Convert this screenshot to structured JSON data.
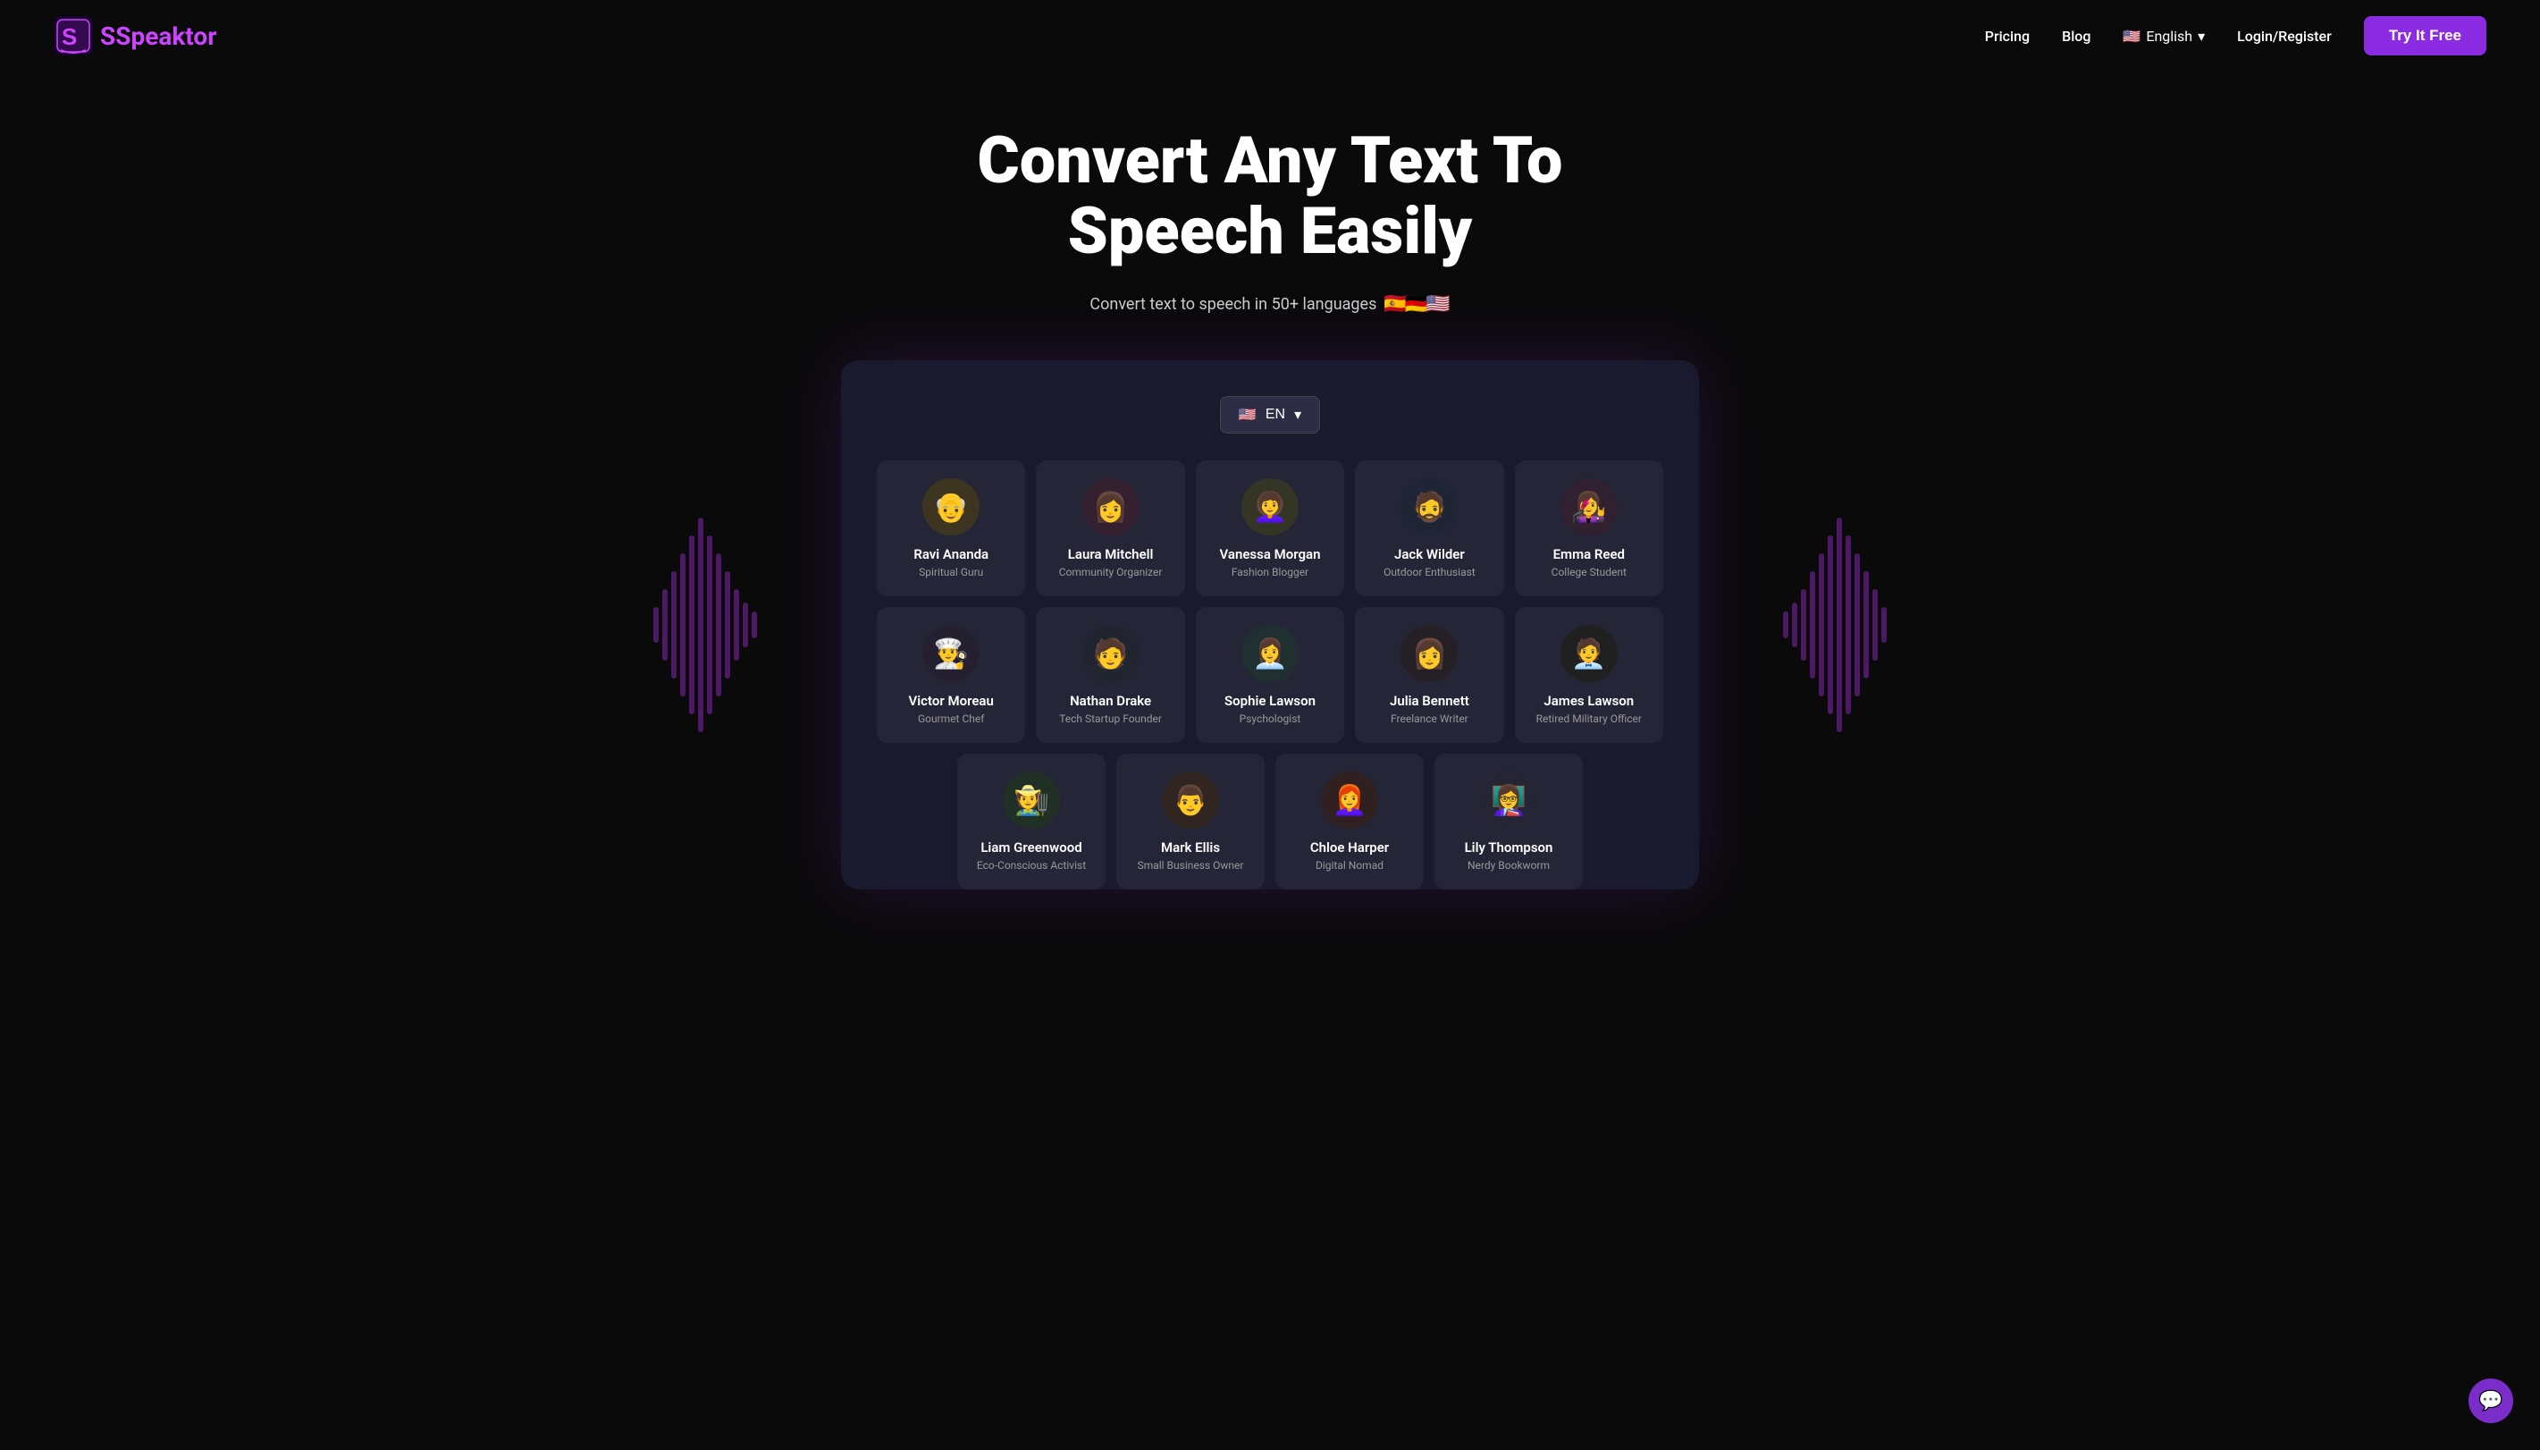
{
  "nav": {
    "logo_text": "Speaktor",
    "logo_s": "S",
    "links": [
      {
        "label": "Pricing",
        "id": "pricing"
      },
      {
        "label": "Blog",
        "id": "blog"
      },
      {
        "label": "English",
        "id": "language"
      },
      {
        "label": "Login/Register",
        "id": "login"
      }
    ],
    "cta_label": "Try It Free",
    "lang_code": "English"
  },
  "hero": {
    "title": "Convert Any Text To Speech Easily",
    "subtitle": "Convert text to speech in 50+ languages",
    "flags": [
      "🇪🇸",
      "🇩🇪",
      "🇺🇸"
    ]
  },
  "app": {
    "lang_dropdown": {
      "label": "EN",
      "flag": "🇺🇸"
    },
    "voices_row1": [
      {
        "name": "Ravi Ananda",
        "role": "Spiritual Guru",
        "avatar": "👴",
        "avatar_class": "av-ravi"
      },
      {
        "name": "Laura Mitchell",
        "role": "Community Organizer",
        "avatar": "👩",
        "avatar_class": "av-laura"
      },
      {
        "name": "Vanessa Morgan",
        "role": "Fashion Blogger",
        "avatar": "👩‍🦱",
        "avatar_class": "av-vanessa"
      },
      {
        "name": "Jack Wilder",
        "role": "Outdoor Enthusiast",
        "avatar": "🧔",
        "avatar_class": "av-jack"
      },
      {
        "name": "Emma Reed",
        "role": "College Student",
        "avatar": "👩‍🎤",
        "avatar_class": "av-emma"
      }
    ],
    "voices_row2": [
      {
        "name": "Victor Moreau",
        "role": "Gourmet Chef",
        "avatar": "👨‍🍳",
        "avatar_class": "av-victor"
      },
      {
        "name": "Nathan Drake",
        "role": "Tech Startup Founder",
        "avatar": "🧑",
        "avatar_class": "av-nathan"
      },
      {
        "name": "Sophie Lawson",
        "role": "Psychologist",
        "avatar": "👩‍💼",
        "avatar_class": "av-sophie"
      },
      {
        "name": "Julia Bennett",
        "role": "Freelance Writer",
        "avatar": "👩",
        "avatar_class": "av-julia"
      },
      {
        "name": "James Lawson",
        "role": "Retired Military Officer",
        "avatar": "🧑‍💼",
        "avatar_class": "av-james"
      }
    ],
    "voices_row3": [
      {
        "name": "Liam Greenwood",
        "role": "Eco-Conscious Activist",
        "avatar": "🧑‍🌾",
        "avatar_class": "av-liam"
      },
      {
        "name": "Mark Ellis",
        "role": "Small Business Owner",
        "avatar": "👨",
        "avatar_class": "av-mark"
      },
      {
        "name": "Chloe Harper",
        "role": "Digital Nomad",
        "avatar": "👩‍🦰",
        "avatar_class": "av-chloe"
      },
      {
        "name": "Lily Thompson",
        "role": "Nerdy Bookworm",
        "avatar": "👩‍🏫",
        "avatar_class": "av-lily"
      }
    ]
  },
  "chat_icon": "💬"
}
